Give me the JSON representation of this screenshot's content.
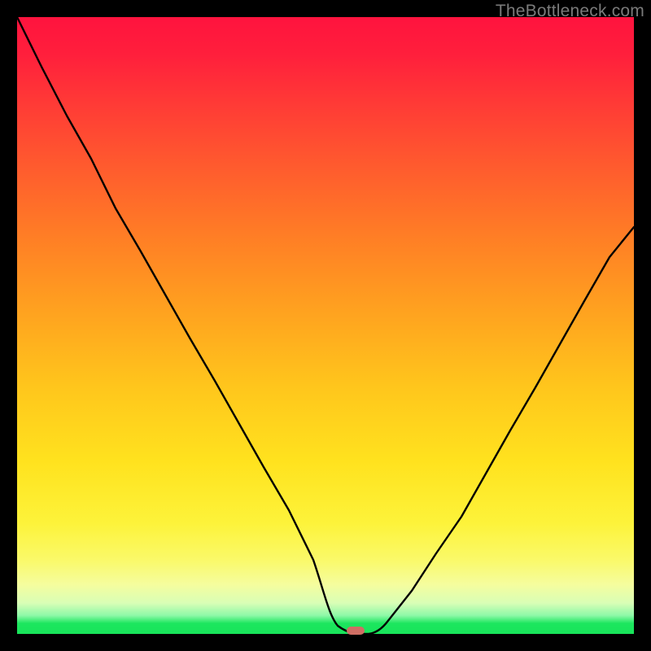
{
  "watermark": "TheBottleneck.com",
  "colors": {
    "frame": "#000000",
    "curve": "#000000",
    "marker": "#cf6e64",
    "gradient_top": "#ff133e",
    "gradient_bottom": "#18e45a"
  },
  "chart_data": {
    "type": "line",
    "title": "",
    "xlabel": "",
    "ylabel": "",
    "xlim": [
      0,
      100
    ],
    "ylim": [
      0,
      100
    ],
    "grid": false,
    "legend": false,
    "note": "No numeric axis ticks are rendered in the screenshot. x and y are normalized 0–100 (left-to-right, bottom-to-top). Values are visual estimates read off the image.",
    "series": [
      {
        "name": "bottleneck-curve",
        "x": [
          0,
          4,
          8,
          12,
          16,
          20,
          24,
          28,
          32,
          36,
          40,
          44,
          48,
          51,
          54,
          56,
          57,
          60,
          64,
          68,
          72,
          76,
          80,
          84,
          88,
          92,
          96,
          100
        ],
        "y": [
          100,
          92,
          84,
          77,
          69,
          62,
          55,
          48,
          41,
          34,
          27,
          20,
          12,
          5,
          1,
          0,
          0,
          2,
          7,
          13,
          19,
          26,
          33,
          40,
          47,
          54,
          61,
          66
        ]
      }
    ],
    "marker": {
      "x": 55,
      "y": 0,
      "label": ""
    },
    "background_gradient_bands_note": "Vertical gradient encodes bottleneck severity: red (top, high y) = severe, green (bottom, low y) = balanced."
  }
}
